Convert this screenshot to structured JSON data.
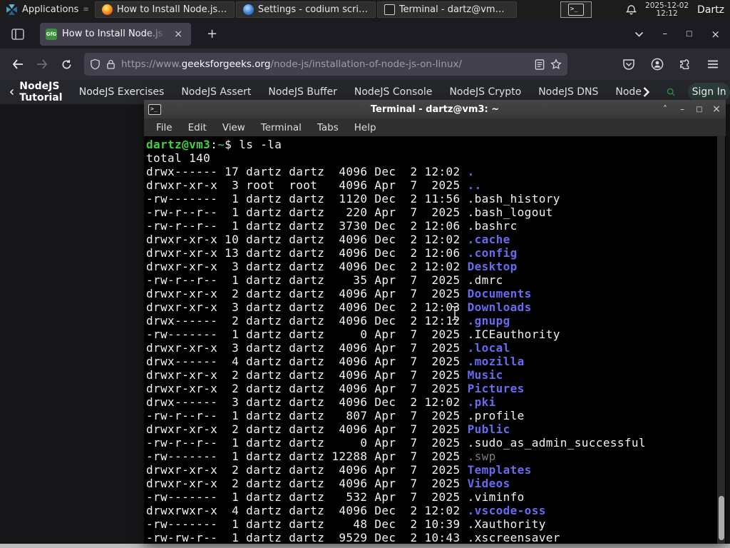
{
  "panel": {
    "applications_label": "Applications",
    "tasks": [
      {
        "label": "How to Install Node.js o...",
        "icon": "icon-firefox"
      },
      {
        "label": "Settings - codium script...",
        "icon": "icon-codium"
      },
      {
        "label": "Terminal - dartz@vm3: ~",
        "icon": "icon-terminal"
      }
    ],
    "clock_date": "2025-12-02",
    "clock_time": "12:12",
    "user": "Dartz"
  },
  "browser": {
    "tab_title": "How to Install Node.js on",
    "tab_close": "×",
    "new_tab": "+",
    "favicon_text": "GfG",
    "url_prefix": "https://www.",
    "url_domain": "geeksforgeeks.org",
    "url_path": "/node-js/installation-of-node-js-on-linux/",
    "window_minimize": "–",
    "window_maximize": "□",
    "window_close": "×"
  },
  "site_nav": {
    "back_label": "NodeJS Tutorial",
    "links": [
      {
        "label": "NodeJS Exercises"
      },
      {
        "label": "NodeJS Assert"
      },
      {
        "label": "NodeJS Buffer"
      },
      {
        "label": "NodeJS Console"
      },
      {
        "label": "NodeJS Crypto"
      },
      {
        "label": "NodeJS DNS"
      },
      {
        "label": "Node"
      }
    ],
    "sign_in": "Sign In"
  },
  "terminal": {
    "title": "Terminal - dartz@vm3: ~",
    "icon_glyph": ">_",
    "shade_btn": "˄",
    "minimize_btn": "–",
    "maximize_btn": "□",
    "close_btn": "×",
    "menu": [
      {
        "label": "File"
      },
      {
        "label": "Edit"
      },
      {
        "label": "View"
      },
      {
        "label": "Terminal"
      },
      {
        "label": "Tabs"
      },
      {
        "label": "Help"
      }
    ],
    "prompt_user_host": "dartz@vm3",
    "prompt_colon": ":",
    "prompt_cwd": "~",
    "prompt_dollar": "$ ",
    "prompt_command": "ls -la",
    "total_line": "total 140",
    "rows": [
      {
        "meta": "drwx------ 17 dartz dartz  4096 Dec  2 12:02 ",
        "name": ".",
        "kind": "dir"
      },
      {
        "meta": "drwxr-xr-x  3 root  root   4096 Apr  7  2025 ",
        "name": "..",
        "kind": "dir"
      },
      {
        "meta": "-rw-------  1 dartz dartz  1120 Dec  2 11:56 ",
        "name": ".bash_history",
        "kind": "file"
      },
      {
        "meta": "-rw-r--r--  1 dartz dartz   220 Apr  7  2025 ",
        "name": ".bash_logout",
        "kind": "file"
      },
      {
        "meta": "-rw-r--r--  1 dartz dartz  3730 Dec  2 12:06 ",
        "name": ".bashrc",
        "kind": "file"
      },
      {
        "meta": "drwxr-xr-x 10 dartz dartz  4096 Dec  2 12:02 ",
        "name": ".cache",
        "kind": "dir"
      },
      {
        "meta": "drwxr-xr-x 13 dartz dartz  4096 Dec  2 12:06 ",
        "name": ".config",
        "kind": "dir"
      },
      {
        "meta": "drwxr-xr-x  3 dartz dartz  4096 Dec  2 12:02 ",
        "name": "Desktop",
        "kind": "dir"
      },
      {
        "meta": "-rw-r--r--  1 dartz dartz    35 Apr  7  2025 ",
        "name": ".dmrc",
        "kind": "file"
      },
      {
        "meta": "drwxr-xr-x  2 dartz dartz  4096 Apr  7  2025 ",
        "name": "Documents",
        "kind": "dir"
      },
      {
        "meta": "drwxr-xr-x  3 dartz dartz  4096 Dec  2 12:03 ",
        "name": "Downloads",
        "kind": "dir"
      },
      {
        "meta": "drwx------  2 dartz dartz  4096 Dec  2 12:12 ",
        "name": ".gnupg",
        "kind": "dir"
      },
      {
        "meta": "-rw-------  1 dartz dartz     0 Apr  7  2025 ",
        "name": ".ICEauthority",
        "kind": "file"
      },
      {
        "meta": "drwxr-xr-x  3 dartz dartz  4096 Apr  7  2025 ",
        "name": ".local",
        "kind": "dir"
      },
      {
        "meta": "drwx------  4 dartz dartz  4096 Apr  7  2025 ",
        "name": ".mozilla",
        "kind": "dir"
      },
      {
        "meta": "drwxr-xr-x  2 dartz dartz  4096 Apr  7  2025 ",
        "name": "Music",
        "kind": "dir"
      },
      {
        "meta": "drwxr-xr-x  2 dartz dartz  4096 Apr  7  2025 ",
        "name": "Pictures",
        "kind": "dir"
      },
      {
        "meta": "drwx------  3 dartz dartz  4096 Dec  2 12:02 ",
        "name": ".pki",
        "kind": "dir"
      },
      {
        "meta": "-rw-r--r--  1 dartz dartz   807 Apr  7  2025 ",
        "name": ".profile",
        "kind": "file"
      },
      {
        "meta": "drwxr-xr-x  2 dartz dartz  4096 Apr  7  2025 ",
        "name": "Public",
        "kind": "dir"
      },
      {
        "meta": "-rw-r--r--  1 dartz dartz     0 Apr  7  2025 ",
        "name": ".sudo_as_admin_successful",
        "kind": "file"
      },
      {
        "meta": "-rw-------  1 dartz dartz 12288 Apr  7  2025 ",
        "name": ".swp",
        "kind": "dim"
      },
      {
        "meta": "drwxr-xr-x  2 dartz dartz  4096 Apr  7  2025 ",
        "name": "Templates",
        "kind": "dir"
      },
      {
        "meta": "drwxr-xr-x  2 dartz dartz  4096 Apr  7  2025 ",
        "name": "Videos",
        "kind": "dir"
      },
      {
        "meta": "-rw-------  1 dartz dartz   532 Apr  7  2025 ",
        "name": ".viminfo",
        "kind": "file"
      },
      {
        "meta": "drwxrwxr-x  4 dartz dartz  4096 Dec  2 12:02 ",
        "name": ".vscode-oss",
        "kind": "dir"
      },
      {
        "meta": "-rw-------  1 dartz dartz    48 Dec  2 10:39 ",
        "name": ".Xauthority",
        "kind": "file"
      },
      {
        "meta": "-rw-rw-r--  1 dartz dartz  9529 Dec  2 10:43 ",
        "name": ".xscreensaver",
        "kind": "file"
      }
    ]
  },
  "colors": {
    "accent_green": "#2f8d46",
    "dir_blue": "#6a6af0",
    "prompt_green": "#3fd23f",
    "panel_bg": "#1c1c1c",
    "terminal_bg": "#000000"
  }
}
